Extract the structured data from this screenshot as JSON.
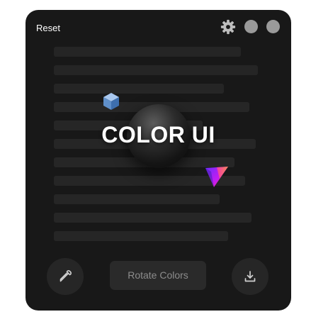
{
  "header": {
    "reset_label": "Reset",
    "settings_icon": "gear-icon",
    "window_dots": [
      "circle-button",
      "circle-button"
    ]
  },
  "hero": {
    "title": "COLOR UI",
    "decorations": [
      "sphere",
      "blue-cube-icon",
      "gradient-prism-icon"
    ]
  },
  "toolbar": {
    "eyedropper_icon": "eyedropper-icon",
    "rotate_label": "Rotate Colors",
    "download_icon": "download-icon"
  },
  "colors": {
    "panel_background": "#181818",
    "button_background": "#262626",
    "dot_gray": "#9a9a9a",
    "cube_blue": "#7fa7d6",
    "prism_purple": "#b41cf0",
    "prism_pink": "#ff2c8c"
  }
}
